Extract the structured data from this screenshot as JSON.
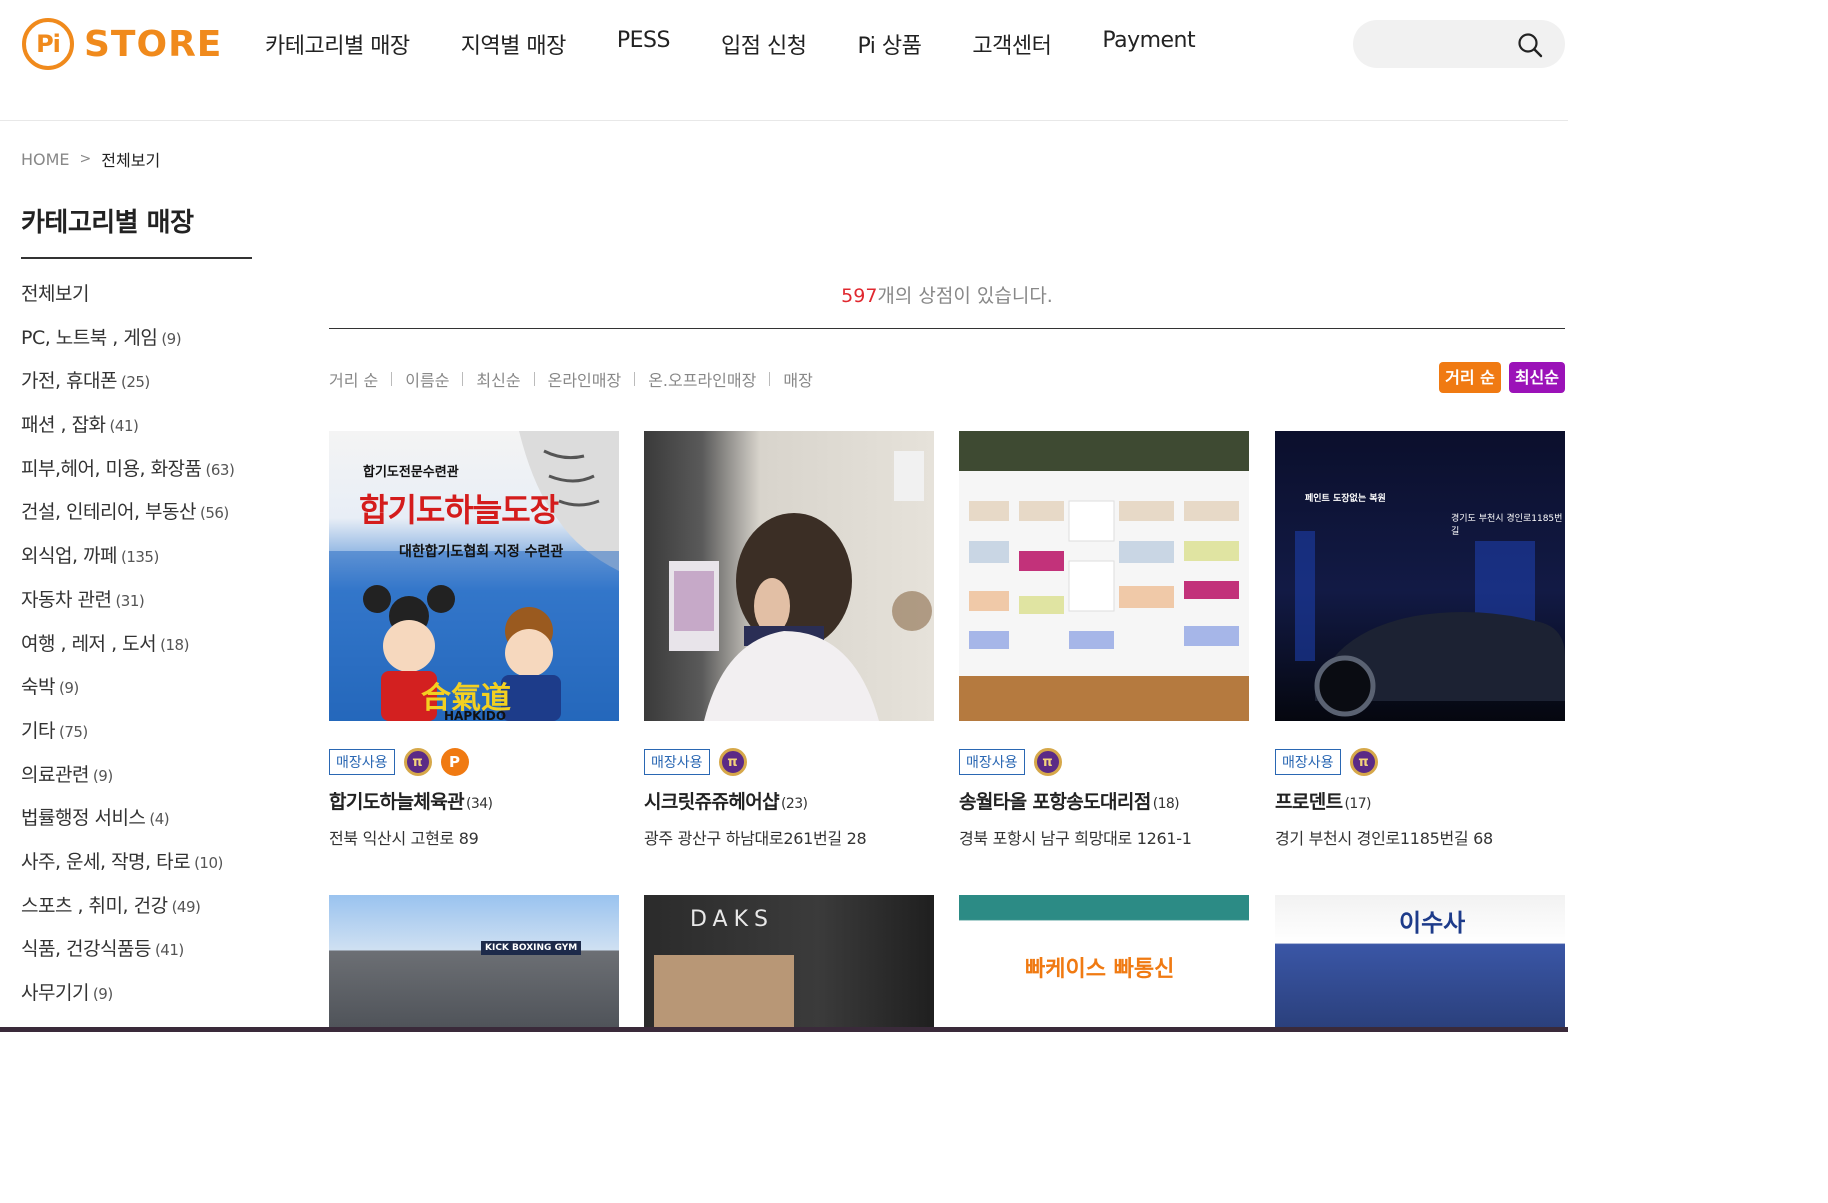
{
  "header": {
    "logo_pi": "Pi",
    "logo_store": "STORE",
    "nav": [
      "카테고리별 매장",
      "지역별 매장",
      "PESS",
      "입점 신청",
      "Pi 상품",
      "고객센터",
      "Payment"
    ],
    "search": {
      "placeholder": "",
      "icon": "search-icon"
    }
  },
  "breadcrumb": {
    "home": "HOME",
    "separator": ">",
    "current": "전체보기"
  },
  "sidebar": {
    "title": "카테고리별 매장",
    "items": [
      {
        "label": "전체보기",
        "count": ""
      },
      {
        "label": "PC, 노트북 , 게임",
        "count": "(9)"
      },
      {
        "label": "가전, 휴대폰",
        "count": "(25)"
      },
      {
        "label": "패션 , 잡화",
        "count": "(41)"
      },
      {
        "label": "피부,헤어, 미용, 화장품",
        "count": "(63)"
      },
      {
        "label": "건설, 인테리어, 부동산",
        "count": "(56)"
      },
      {
        "label": "외식업, 까페",
        "count": "(135)"
      },
      {
        "label": "자동차 관련",
        "count": "(31)"
      },
      {
        "label": "여행 , 레저 , 도서",
        "count": "(18)"
      },
      {
        "label": "숙박",
        "count": "(9)"
      },
      {
        "label": "기타",
        "count": "(75)"
      },
      {
        "label": "의료관련",
        "count": "(9)"
      },
      {
        "label": "법률행정 서비스",
        "count": "(4)"
      },
      {
        "label": "사주, 운세, 작명, 타로",
        "count": "(10)"
      },
      {
        "label": "스포츠 , 취미, 건강",
        "count": "(49)"
      },
      {
        "label": "식품, 건강식품등",
        "count": "(41)"
      },
      {
        "label": "사무기기",
        "count": "(9)"
      }
    ]
  },
  "main": {
    "total_count": "597",
    "total_suffix": "개의 상점이 있습니다.",
    "sort_links": [
      "거리 순",
      "이름순",
      "최신순",
      "온라인매장",
      "온.오프라인매장",
      "매장"
    ],
    "sort_buttons": {
      "distance": "거리 순",
      "newest": "최신순"
    },
    "colors": {
      "accent": "#f07a12",
      "purple": "#9b12b8",
      "count_red": "#e0282f",
      "badge_blue": "#2a67b3"
    },
    "stores": [
      {
        "badge": "매장사용",
        "coins": [
          "pi",
          "p"
        ],
        "name": "합기도하늘체육관",
        "count": "(34)",
        "address": "전북 익산시 고현로 89",
        "image_text": {
          "top": "합기도전문수련관",
          "title": "합기도하늘도장",
          "sub": "대한합기도협회 지정 수련관",
          "kanji": "合氣道",
          "roman": "HAPKIDO"
        }
      },
      {
        "badge": "매장사용",
        "coins": [
          "pi"
        ],
        "name": "시크릿쥬쥬헤어샵",
        "count": "(23)",
        "address": "광주 광산구 하남대로261번길 28"
      },
      {
        "badge": "매장사용",
        "coins": [
          "pi"
        ],
        "name": "송월타올 포항송도대리점",
        "count": "(18)",
        "address": "경북 포항시 남구 희망대로 1261-1"
      },
      {
        "badge": "매장사용",
        "coins": [
          "pi"
        ],
        "name": "프로덴트",
        "count": "(17)",
        "address": "경기 부천시 경인로1185번길 68",
        "image_text": {
          "top": "페인트 도장없는 복원",
          "address": "경기도 부천시 경인로1185번길"
        }
      }
    ],
    "row2_image_text": [
      "KICK BOXING GYM",
      "DAKS",
      "빠케이스 빠통신",
      "이수사"
    ]
  }
}
